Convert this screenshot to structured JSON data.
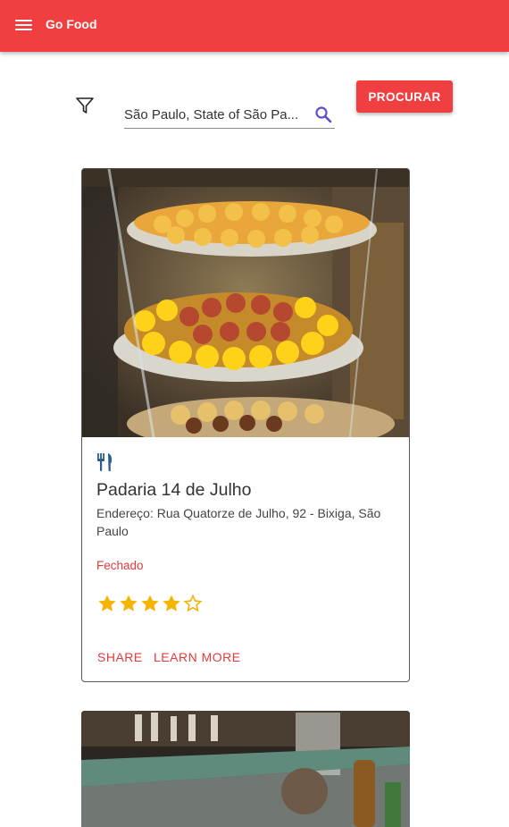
{
  "app": {
    "title": "Go Food"
  },
  "search": {
    "value": "São Paulo, State of São Pa...",
    "button_label": "PROCURAR"
  },
  "cards": [
    {
      "title": "Padaria 14 de Julho",
      "address": "Endereço: Rua Quatorze de Julho, 92 - Bixiga, São Paulo",
      "status": "Fechado",
      "rating": 4,
      "rating_max": 5,
      "actions": {
        "share": "SHARE",
        "learn_more": "LEARN MORE"
      }
    }
  ],
  "icons": {
    "menu": "menu-icon",
    "filter": "filter-icon",
    "search": "search-icon",
    "restaurant": "restaurant-icon",
    "star": "star-icon"
  },
  "colors": {
    "primary": "#ef3f40",
    "search_icon": "#5b4fc7",
    "restaurant_icon": "#2a5f8f",
    "star": "#f5b400",
    "status": "#e5393b"
  }
}
